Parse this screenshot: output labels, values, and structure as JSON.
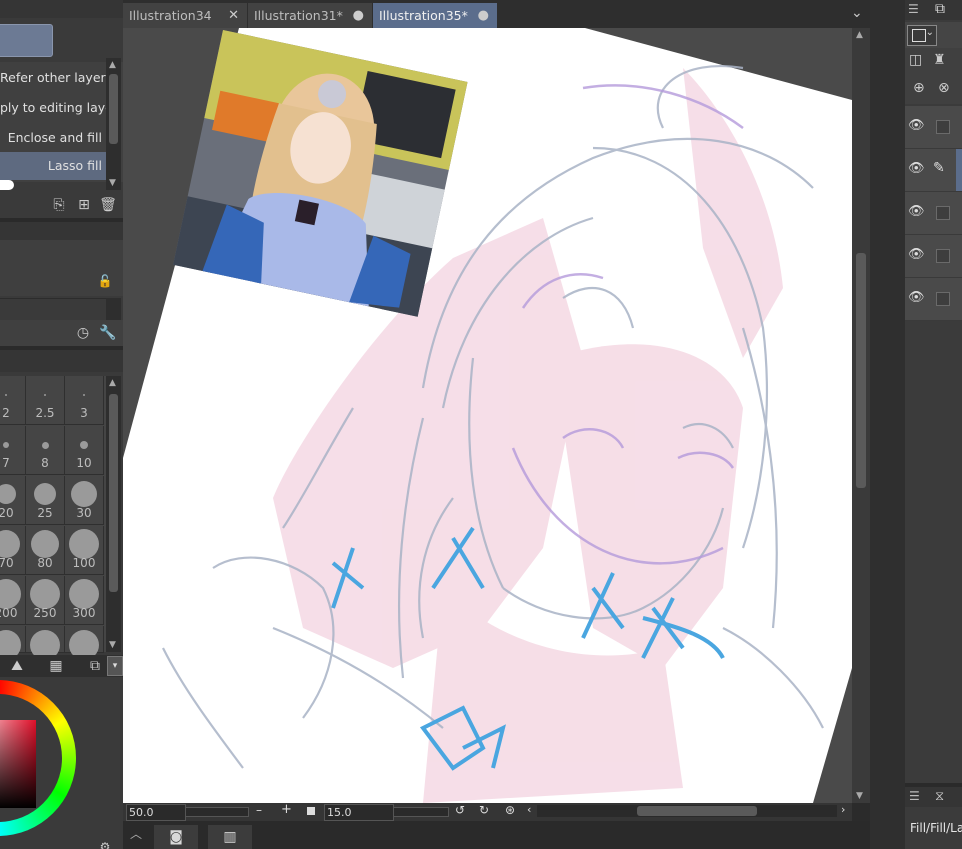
{
  "tabs": [
    {
      "label": "Illustration34",
      "close": "✕"
    },
    {
      "label": "Illustration31*",
      "close": "●"
    },
    {
      "label": "Illustration35*",
      "close": "●"
    }
  ],
  "tab_overflow": "⌄",
  "subtools": [
    "Refer other layers",
    "ply to editing layer",
    "Enclose and fill",
    "Lasso fill"
  ],
  "brush_sizes": [
    [
      "2",
      "2.5",
      "3"
    ],
    [
      "7",
      "8",
      "10"
    ],
    [
      "20",
      "25",
      "30"
    ],
    [
      "70",
      "80",
      "100"
    ],
    [
      "200",
      "250",
      "300"
    ]
  ],
  "bottom": {
    "zoom": "50.0",
    "rotate": "15.0",
    "minus": "–",
    "plus": "+"
  },
  "status_label": "Fill/Fill/La",
  "colors": {
    "accent": "#5b6d8c",
    "panel": "#3a3a3a",
    "canvas_bg": "#4a4a4a",
    "paper": "#ffffff"
  }
}
